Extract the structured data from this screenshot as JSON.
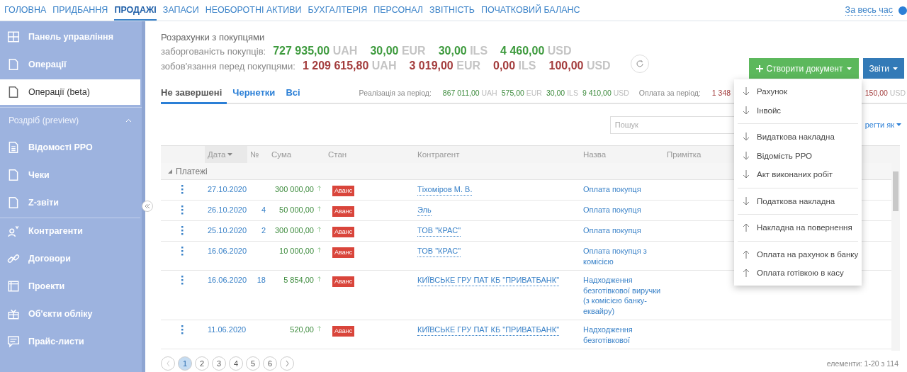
{
  "top_nav": {
    "items": [
      {
        "label": "ГОЛОВНА",
        "selected": false
      },
      {
        "label": "ПРИДБАННЯ",
        "selected": false
      },
      {
        "label": "ПРОДАЖІ",
        "selected": true
      },
      {
        "label": "ЗАПАСИ",
        "selected": false
      },
      {
        "label": "НЕОБОРОТНІ АКТИВИ",
        "selected": false
      },
      {
        "label": "БУХГАЛТЕРІЯ",
        "selected": false
      },
      {
        "label": "ПЕРСОНАЛ",
        "selected": false
      },
      {
        "label": "ЗВІТНІСТЬ",
        "selected": false
      },
      {
        "label": "ПОЧАТКОВИЙ БАЛАНС",
        "selected": false
      }
    ],
    "period": "За весь час"
  },
  "sidebar": {
    "items": [
      {
        "kind": "item",
        "label": "Панель управління",
        "selected": false
      },
      {
        "kind": "item",
        "label": "Операції",
        "selected": false
      },
      {
        "kind": "item",
        "label": "Операції (beta)",
        "selected": true
      },
      {
        "kind": "section",
        "label": "Роздріб (preview)",
        "expanded": true,
        "children": [
          {
            "kind": "item",
            "label": "Відомості РРО",
            "selected": false
          },
          {
            "kind": "item",
            "label": "Чеки",
            "selected": false
          },
          {
            "kind": "item",
            "label": "Z-звіти",
            "selected": false
          }
        ]
      },
      {
        "kind": "item",
        "label": "Контрагенти",
        "selected": false
      },
      {
        "kind": "item",
        "label": "Договори",
        "selected": false
      },
      {
        "kind": "item",
        "label": "Проекти",
        "selected": false
      },
      {
        "kind": "item",
        "label": "Об'єкти обліку",
        "selected": false
      },
      {
        "kind": "item",
        "label": "Прайс-листи",
        "selected": false
      }
    ]
  },
  "summary": {
    "title": "Розрахунки з покупцями",
    "lines": [
      {
        "kind": "positive",
        "label": "заборгованість покупців:",
        "amounts": [
          {
            "value": "727 935,00",
            "currency": "UAH"
          },
          {
            "value": "30,00",
            "currency": "EUR"
          },
          {
            "value": "30,00",
            "currency": "ILS"
          },
          {
            "value": "4 460,00",
            "currency": "USD"
          }
        ]
      },
      {
        "kind": "negative",
        "label": "зобов'язання перед покупцями:",
        "amounts": [
          {
            "value": "1 209 615,80",
            "currency": "UAH"
          },
          {
            "value": "3 019,00",
            "currency": "EUR"
          },
          {
            "value": "0,00",
            "currency": "ILS"
          },
          {
            "value": "100,00",
            "currency": "USD"
          }
        ]
      }
    ]
  },
  "actions": {
    "create": "Створити документ",
    "reports": "Звіти"
  },
  "tabs": [
    {
      "label": "Не завершені",
      "selected": true
    },
    {
      "label": "Чернетки",
      "selected": false
    },
    {
      "label": "Всі",
      "selected": false
    }
  ],
  "period_totals": {
    "sales_label": "Реалізація за період:",
    "sales": [
      {
        "value": "867 011,00",
        "currency": "UAH"
      },
      {
        "value": "575,00",
        "currency": "EUR"
      },
      {
        "value": "30,00",
        "currency": "ILS"
      },
      {
        "value": "9 410,00",
        "currency": "USD"
      }
    ],
    "payments_label": "Оплата за період:",
    "payments_start": "1 348",
    "payments_end": {
      "value": "150,00",
      "currency": "USD"
    }
  },
  "search": {
    "placeholder": "Пошук"
  },
  "save_as": "регти як",
  "create_menu": [
    [
      {
        "kind": "in",
        "label": "Рахунок"
      },
      {
        "kind": "in",
        "label": "Інвойс"
      }
    ],
    [
      {
        "kind": "in",
        "label": "Видаткова накладна"
      },
      {
        "kind": "in",
        "label": "Відомість РРО"
      },
      {
        "kind": "in",
        "label": "Акт виконаних робіт"
      }
    ],
    [
      {
        "kind": "in",
        "label": "Податкова накладна"
      }
    ],
    [
      {
        "kind": "out",
        "label": "Накладна на повернення"
      }
    ],
    [
      {
        "kind": "out",
        "label": "Оплата на рахунок в банку"
      },
      {
        "kind": "out",
        "label": "Оплата готівкою в касу"
      }
    ]
  ],
  "table": {
    "columns": [
      "Дата",
      "№",
      "Сума",
      "Стан",
      "Контрагент",
      "Назва",
      "Примітка"
    ],
    "group": {
      "label": "Платежі",
      "expanded": true
    },
    "rows": [
      {
        "date": "27.10.2020",
        "number": "",
        "amount": "300 000,00",
        "status": "Аванс",
        "counterparty": "Тіхоміров М. В.",
        "name": "Оплата покупця"
      },
      {
        "date": "26.10.2020",
        "number": "4",
        "amount": "50 000,00",
        "status": "Аванс",
        "counterparty": "Эль",
        "name": "Оплата покупця"
      },
      {
        "date": "25.10.2020",
        "number": "2",
        "amount": "300 000,00",
        "status": "Аванс",
        "counterparty": "ТОВ \"КРАС\"",
        "name": "Оплата покупця"
      },
      {
        "date": "16.06.2020",
        "number": "",
        "amount": "10 000,00",
        "status": "Аванс",
        "counterparty": "ТОВ \"КРАС\"",
        "name": "Оплата покупця з комісією"
      },
      {
        "date": "16.06.2020",
        "number": "18",
        "amount": "5 854,00",
        "status": "Аванс",
        "counterparty": "КИЇВСЬКЕ ГРУ ПАТ КБ \"ПРИВАТБАНК\"",
        "name": "Надходження безготівкової виручки (з комісією банку-еквайру)"
      },
      {
        "date": "11.06.2020",
        "number": "",
        "amount": "520,00",
        "status": "Аванс",
        "counterparty": "КИЇВСЬКЕ ГРУ ПАТ КБ \"ПРИВАТБАНК\"",
        "name": "Надходження безготівкової"
      }
    ]
  },
  "pagination": {
    "pages": [
      {
        "label": "1",
        "selected": true
      },
      {
        "label": "2",
        "selected": false
      },
      {
        "label": "3",
        "selected": false
      },
      {
        "label": "4",
        "selected": false
      },
      {
        "label": "5",
        "selected": false
      },
      {
        "label": "6",
        "selected": false
      }
    ],
    "count": "елементи: 1-20 з 114"
  }
}
